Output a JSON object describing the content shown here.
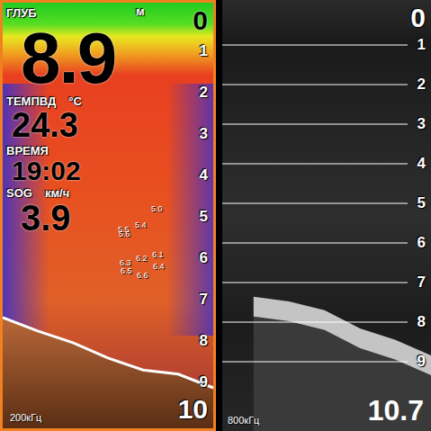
{
  "left_panel": {
    "frequency": "200кГц",
    "depth_label": "ГЛУБ",
    "depth_unit": "м",
    "depth": "8.9",
    "readouts": [
      {
        "label": "ТЕМПВД",
        "unit": "°C",
        "value": "24.3"
      },
      {
        "label": "ВРЕМЯ",
        "unit": "",
        "value": "19:02"
      },
      {
        "label": "SOG",
        "unit": "км/ч",
        "value": "3.9"
      }
    ],
    "scale": [
      "0",
      "1",
      "2",
      "3",
      "4",
      "5",
      "6",
      "7",
      "8",
      "9"
    ],
    "range": "10",
    "fish": [
      "5.5",
      "5.0",
      "5.4",
      "5.6",
      "6.1",
      "6.2",
      "6.3",
      "6.4",
      "6.6",
      "6.5"
    ],
    "bottom": [
      7.43,
      7.76,
      8.04,
      8.41,
      8.7,
      8.8,
      9.13
    ]
  },
  "right_panel": {
    "frequency": "800кГц",
    "scale": [
      "0",
      "1",
      "2",
      "3",
      "4",
      "5",
      "6",
      "7",
      "8",
      "9"
    ],
    "range": "10.7",
    "bottom": [
      7.36,
      7.48,
      7.7,
      8.16,
      8.45,
      8.84
    ]
  }
}
